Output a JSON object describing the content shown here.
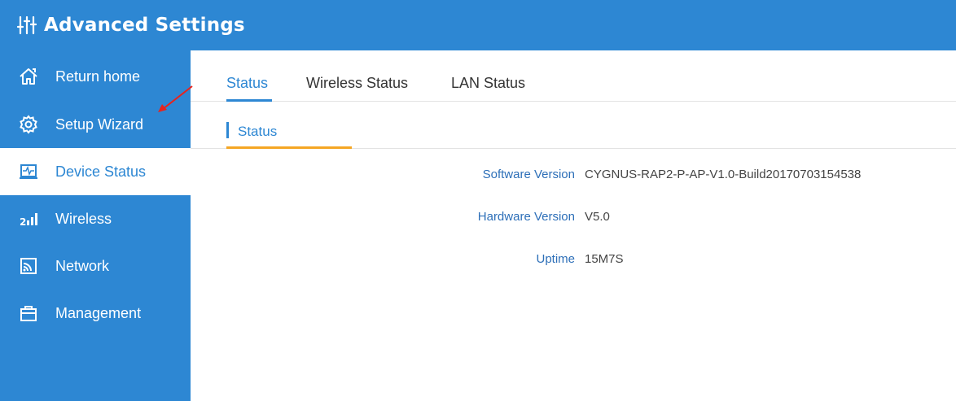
{
  "header": {
    "title": "Advanced Settings",
    "icon": "equalizer-icon"
  },
  "sidebar": {
    "items": [
      {
        "label": "Return home",
        "icon": "home-icon"
      },
      {
        "label": "Setup Wizard",
        "icon": "gear-icon"
      },
      {
        "label": "Device Status",
        "icon": "monitor-pulse-icon",
        "active": true
      },
      {
        "label": "Wireless",
        "icon": "signal-bars-icon"
      },
      {
        "label": "Network",
        "icon": "rss-icon"
      },
      {
        "label": "Management",
        "icon": "toolbox-icon"
      }
    ]
  },
  "tabs": [
    {
      "label": "Status",
      "active": true
    },
    {
      "label": "Wireless Status"
    },
    {
      "label": "LAN Status"
    }
  ],
  "section": {
    "title": "Status"
  },
  "status": {
    "software_version_label": "Software Version",
    "software_version": "CYGNUS-RAP2-P-AP-V1.0-Build20170703154538",
    "hardware_version_label": "Hardware Version",
    "hardware_version": "V5.0",
    "uptime_label": "Uptime",
    "uptime": "15M7S"
  },
  "colors": {
    "primary": "#2d87d3",
    "accent": "#f5a623",
    "annotation_arrow": "#e8231c"
  }
}
